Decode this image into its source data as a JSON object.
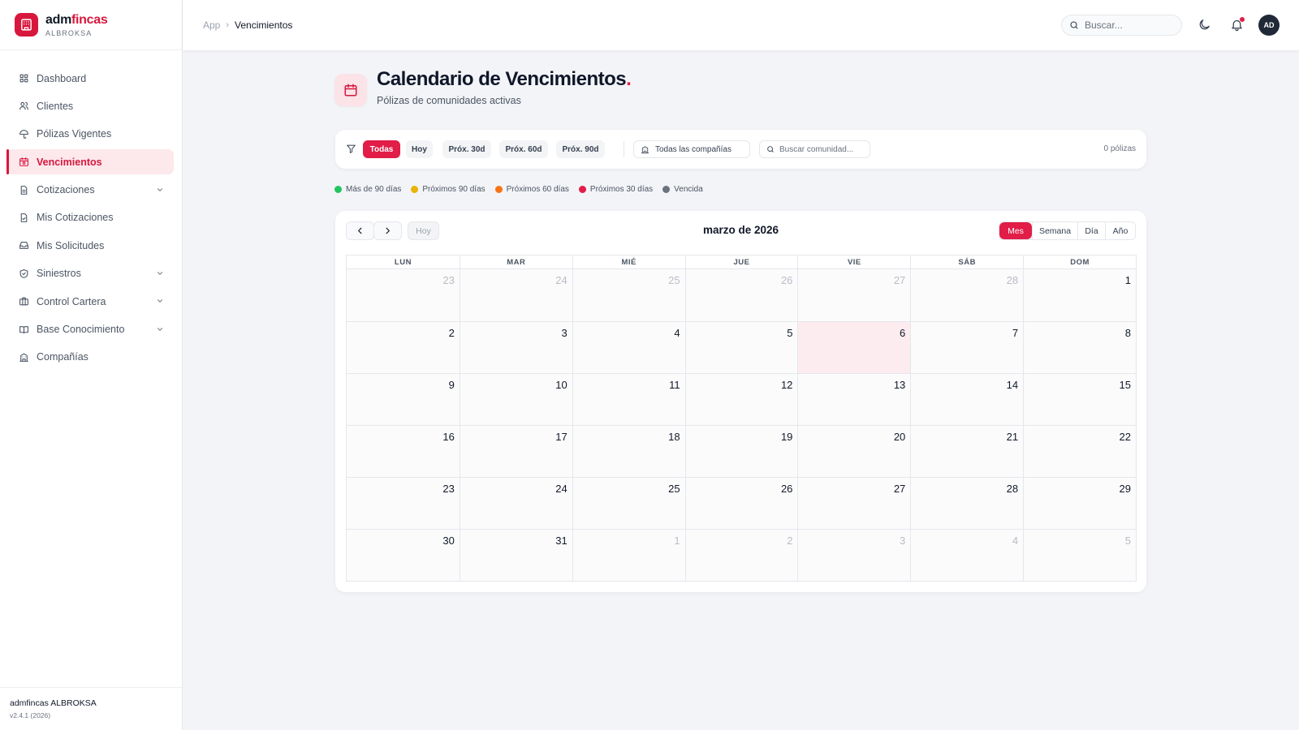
{
  "brand": {
    "name_a": "adm",
    "name_b": "fincas",
    "subtitle": "ALBROKSA"
  },
  "sidebar": {
    "items": [
      {
        "label": "Dashboard",
        "icon": "grid-icon",
        "active": false,
        "expandable": false
      },
      {
        "label": "Clientes",
        "icon": "users-icon",
        "active": false,
        "expandable": false
      },
      {
        "label": "Pólizas Vigentes",
        "icon": "umbrella-icon",
        "active": false,
        "expandable": false
      },
      {
        "label": "Vencimientos",
        "icon": "calendar-clock-icon",
        "active": true,
        "expandable": false
      },
      {
        "label": "Cotizaciones",
        "icon": "document-icon",
        "active": false,
        "expandable": true
      },
      {
        "label": "Mis Cotizaciones",
        "icon": "document-check-icon",
        "active": false,
        "expandable": false
      },
      {
        "label": "Mis Solicitudes",
        "icon": "inbox-icon",
        "active": false,
        "expandable": false
      },
      {
        "label": "Siniestros",
        "icon": "shield-icon",
        "active": false,
        "expandable": true
      },
      {
        "label": "Control Cartera",
        "icon": "briefcase-icon",
        "active": false,
        "expandable": true
      },
      {
        "label": "Base Conocimiento",
        "icon": "book-icon",
        "active": false,
        "expandable": true
      },
      {
        "label": "Compañías",
        "icon": "building-icon",
        "active": false,
        "expandable": false
      }
    ],
    "footer": {
      "name": "admfincas ALBROKSA",
      "version": "v2.4.1 (2026)"
    }
  },
  "topbar": {
    "breadcrumb": {
      "root": "App",
      "current": "Vencimientos"
    },
    "search_placeholder": "Buscar...",
    "avatar_initials": "AD"
  },
  "header": {
    "title": "Calendario de Vencimientos",
    "title_dot": ".",
    "subtitle": "Pólizas de comunidades activas"
  },
  "filters": {
    "buttons": [
      {
        "label": "Todas",
        "active": true
      },
      {
        "label": "Hoy",
        "active": false
      },
      {
        "label": "Próx. 30d",
        "active": false
      },
      {
        "label": "Próx. 60d",
        "active": false
      },
      {
        "label": "Próx. 90d",
        "active": false
      }
    ],
    "company_select": "Todas las compañías",
    "community_search_placeholder": "Buscar comunidad...",
    "count": "0 pólizas"
  },
  "legend": [
    {
      "label": "Más de 90 días",
      "color": "#22c55e"
    },
    {
      "label": "Próximos 90 días",
      "color": "#eab308"
    },
    {
      "label": "Próximos 60 días",
      "color": "#f97316"
    },
    {
      "label": "Próximos 30 días",
      "color": "#e11d48"
    },
    {
      "label": "Vencida",
      "color": "#6b7280"
    }
  ],
  "calendar": {
    "title": "marzo de 2026",
    "today_label": "Hoy",
    "views": [
      {
        "label": "Mes",
        "active": true
      },
      {
        "label": "Semana",
        "active": false
      },
      {
        "label": "Día",
        "active": false
      },
      {
        "label": "Año",
        "active": false
      }
    ],
    "weekdays": [
      "LUN",
      "MAR",
      "MIÉ",
      "JUE",
      "VIE",
      "SÁB",
      "DOM"
    ],
    "weeks": [
      [
        {
          "d": "23",
          "o": true
        },
        {
          "d": "24",
          "o": true
        },
        {
          "d": "25",
          "o": true
        },
        {
          "d": "26",
          "o": true
        },
        {
          "d": "27",
          "o": true
        },
        {
          "d": "28",
          "o": true
        },
        {
          "d": "1",
          "o": false
        }
      ],
      [
        {
          "d": "2",
          "o": false
        },
        {
          "d": "3",
          "o": false
        },
        {
          "d": "4",
          "o": false
        },
        {
          "d": "5",
          "o": false
        },
        {
          "d": "6",
          "o": false,
          "t": true
        },
        {
          "d": "7",
          "o": false
        },
        {
          "d": "8",
          "o": false
        }
      ],
      [
        {
          "d": "9",
          "o": false
        },
        {
          "d": "10",
          "o": false
        },
        {
          "d": "11",
          "o": false
        },
        {
          "d": "12",
          "o": false
        },
        {
          "d": "13",
          "o": false
        },
        {
          "d": "14",
          "o": false
        },
        {
          "d": "15",
          "o": false
        }
      ],
      [
        {
          "d": "16",
          "o": false
        },
        {
          "d": "17",
          "o": false
        },
        {
          "d": "18",
          "o": false
        },
        {
          "d": "19",
          "o": false
        },
        {
          "d": "20",
          "o": false
        },
        {
          "d": "21",
          "o": false
        },
        {
          "d": "22",
          "o": false
        }
      ],
      [
        {
          "d": "23",
          "o": false
        },
        {
          "d": "24",
          "o": false
        },
        {
          "d": "25",
          "o": false
        },
        {
          "d": "26",
          "o": false
        },
        {
          "d": "27",
          "o": false
        },
        {
          "d": "28",
          "o": false
        },
        {
          "d": "29",
          "o": false
        }
      ],
      [
        {
          "d": "30",
          "o": false
        },
        {
          "d": "31",
          "o": false
        },
        {
          "d": "1",
          "o": true
        },
        {
          "d": "2",
          "o": true
        },
        {
          "d": "3",
          "o": true
        },
        {
          "d": "4",
          "o": true
        },
        {
          "d": "5",
          "o": true
        }
      ]
    ]
  },
  "colors": {
    "accent": "#d7173d",
    "accent_soft": "#fde8ec",
    "today_bg": "#fdecef",
    "dark": "#1f2937"
  }
}
